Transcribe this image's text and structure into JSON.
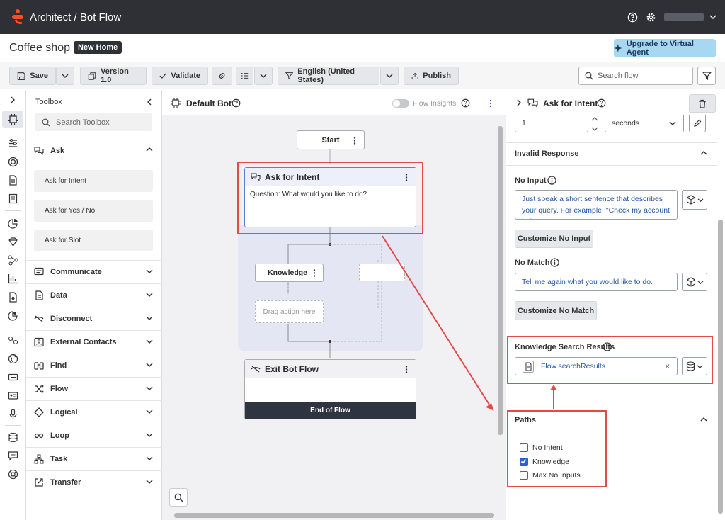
{
  "topbar": {
    "app": "Architect",
    "separator": "/",
    "page": "Bot Flow"
  },
  "flow": {
    "name": "Coffee shop",
    "badge": "New Home",
    "upgrade_label": "Upgrade to Virtual Agent"
  },
  "toolbar": {
    "save": "Save",
    "version": "Version 1.0",
    "validate": "Validate",
    "language": "English (United States)",
    "publish": "Publish",
    "search_placeholder": "Search flow"
  },
  "toolbox": {
    "title": "Toolbox",
    "search_placeholder": "Search Toolbox",
    "ask": {
      "label": "Ask",
      "items": [
        "Ask for Intent",
        "Ask for Yes / No",
        "Ask for Slot"
      ]
    },
    "categories": [
      "Communicate",
      "Data",
      "Disconnect",
      "External Contacts",
      "Find",
      "Flow",
      "Logical",
      "Loop",
      "Task",
      "Transfer"
    ]
  },
  "canvas": {
    "title": "Default Bot",
    "insights_label": "Flow Insights",
    "start": "Start",
    "ask_node": {
      "title": "Ask for Intent",
      "question": "Question: What would you like to do?"
    },
    "knowledge": "Knowledge",
    "drag_hint": "Drag action here",
    "exit_node": {
      "title": "Exit Bot Flow",
      "footer": "End of Flow"
    }
  },
  "panel": {
    "title": "Ask for Intent",
    "timeout_value": "1",
    "timeout_unit": "seconds",
    "invalid_response": "Invalid Response",
    "no_input": {
      "label": "No Input",
      "text": "Just speak a short sentence that describes your query. For example, \"Check my account balance\"",
      "button": "Customize No Input"
    },
    "no_match": {
      "label": "No Match",
      "text": "Tell me again what you would like to do.",
      "button": "Customize No Match"
    },
    "knowledge_results": {
      "label": "Knowledge Search Results",
      "value": "Flow.searchResults"
    },
    "paths": {
      "label": "Paths",
      "items": [
        {
          "label": "No Intent",
          "checked": false
        },
        {
          "label": "Knowledge",
          "checked": true
        },
        {
          "label": "Max No Inputs",
          "checked": false
        }
      ]
    }
  },
  "colors": {
    "topbar": "#2e3035",
    "accent": "#2a62c9",
    "highlight": "#e34b4b",
    "brand": "#ff4f1f"
  }
}
